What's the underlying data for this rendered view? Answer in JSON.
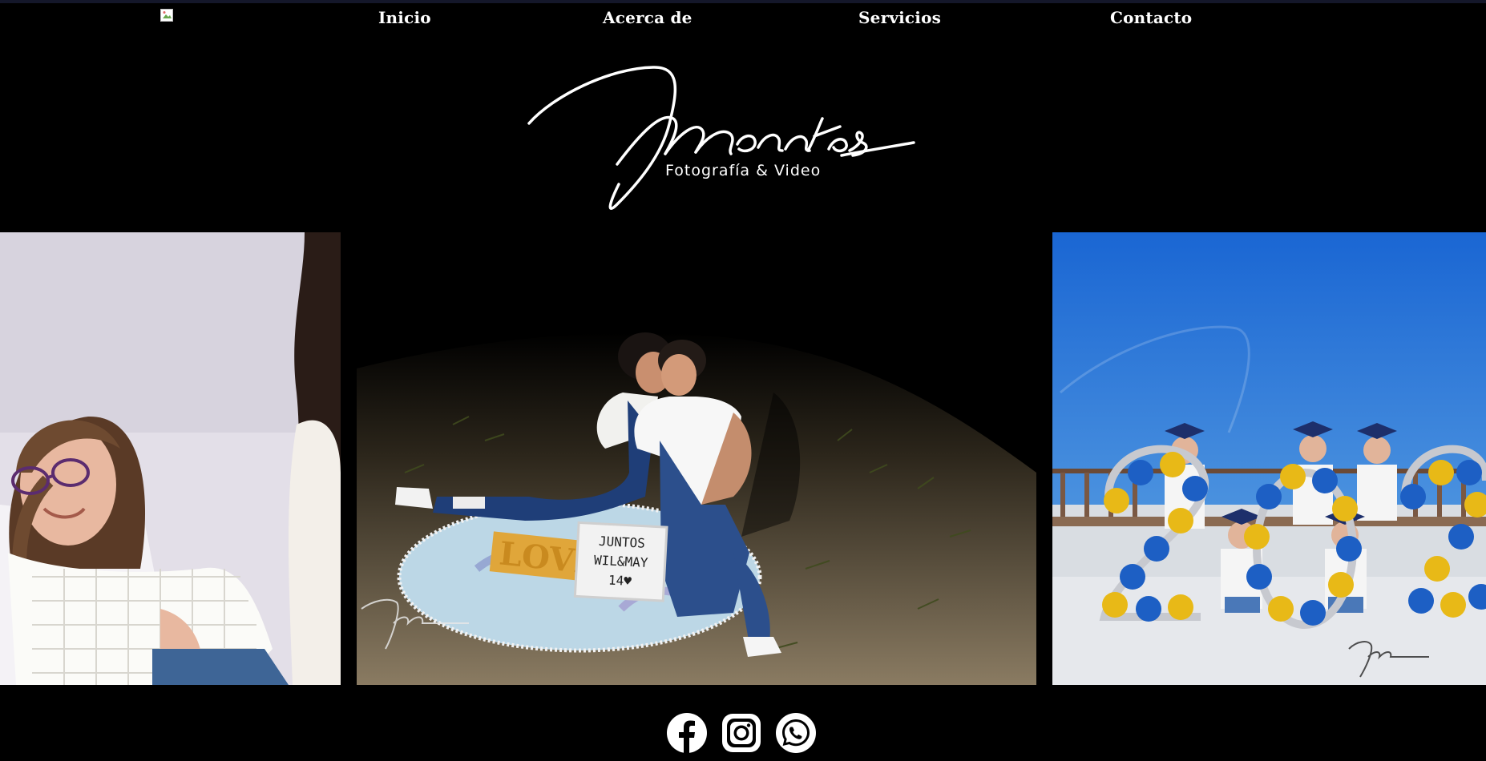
{
  "nav": {
    "broken_image_alt": "",
    "items": [
      {
        "label": "Inicio"
      },
      {
        "label": "Acerca de"
      },
      {
        "label": "Servicios"
      },
      {
        "label": "Contacto"
      }
    ]
  },
  "logo": {
    "wordmark": "Momentos",
    "tagline": "Fotografía & Video"
  },
  "gallery": {
    "photos": [
      {
        "subject": "woman-white-lace-top"
      },
      {
        "subject": "couple-on-beach-blanket",
        "sign_love": "LOVE",
        "letterboard": [
          "JUNTOS",
          "WIL&MAY",
          "14♥"
        ]
      },
      {
        "subject": "children-graduation-balloons"
      }
    ],
    "watermark": "Momentos"
  },
  "social": [
    {
      "icon": "facebook-icon"
    },
    {
      "icon": "instagram-icon"
    },
    {
      "icon": "whatsapp-icon"
    }
  ],
  "colors": {
    "background": "#000000",
    "topline": "#14172a",
    "text": "#ffffff",
    "sky": "#1f6fd6",
    "balloon_blue": "#1d5fc4",
    "balloon_yellow": "#e8b917"
  }
}
